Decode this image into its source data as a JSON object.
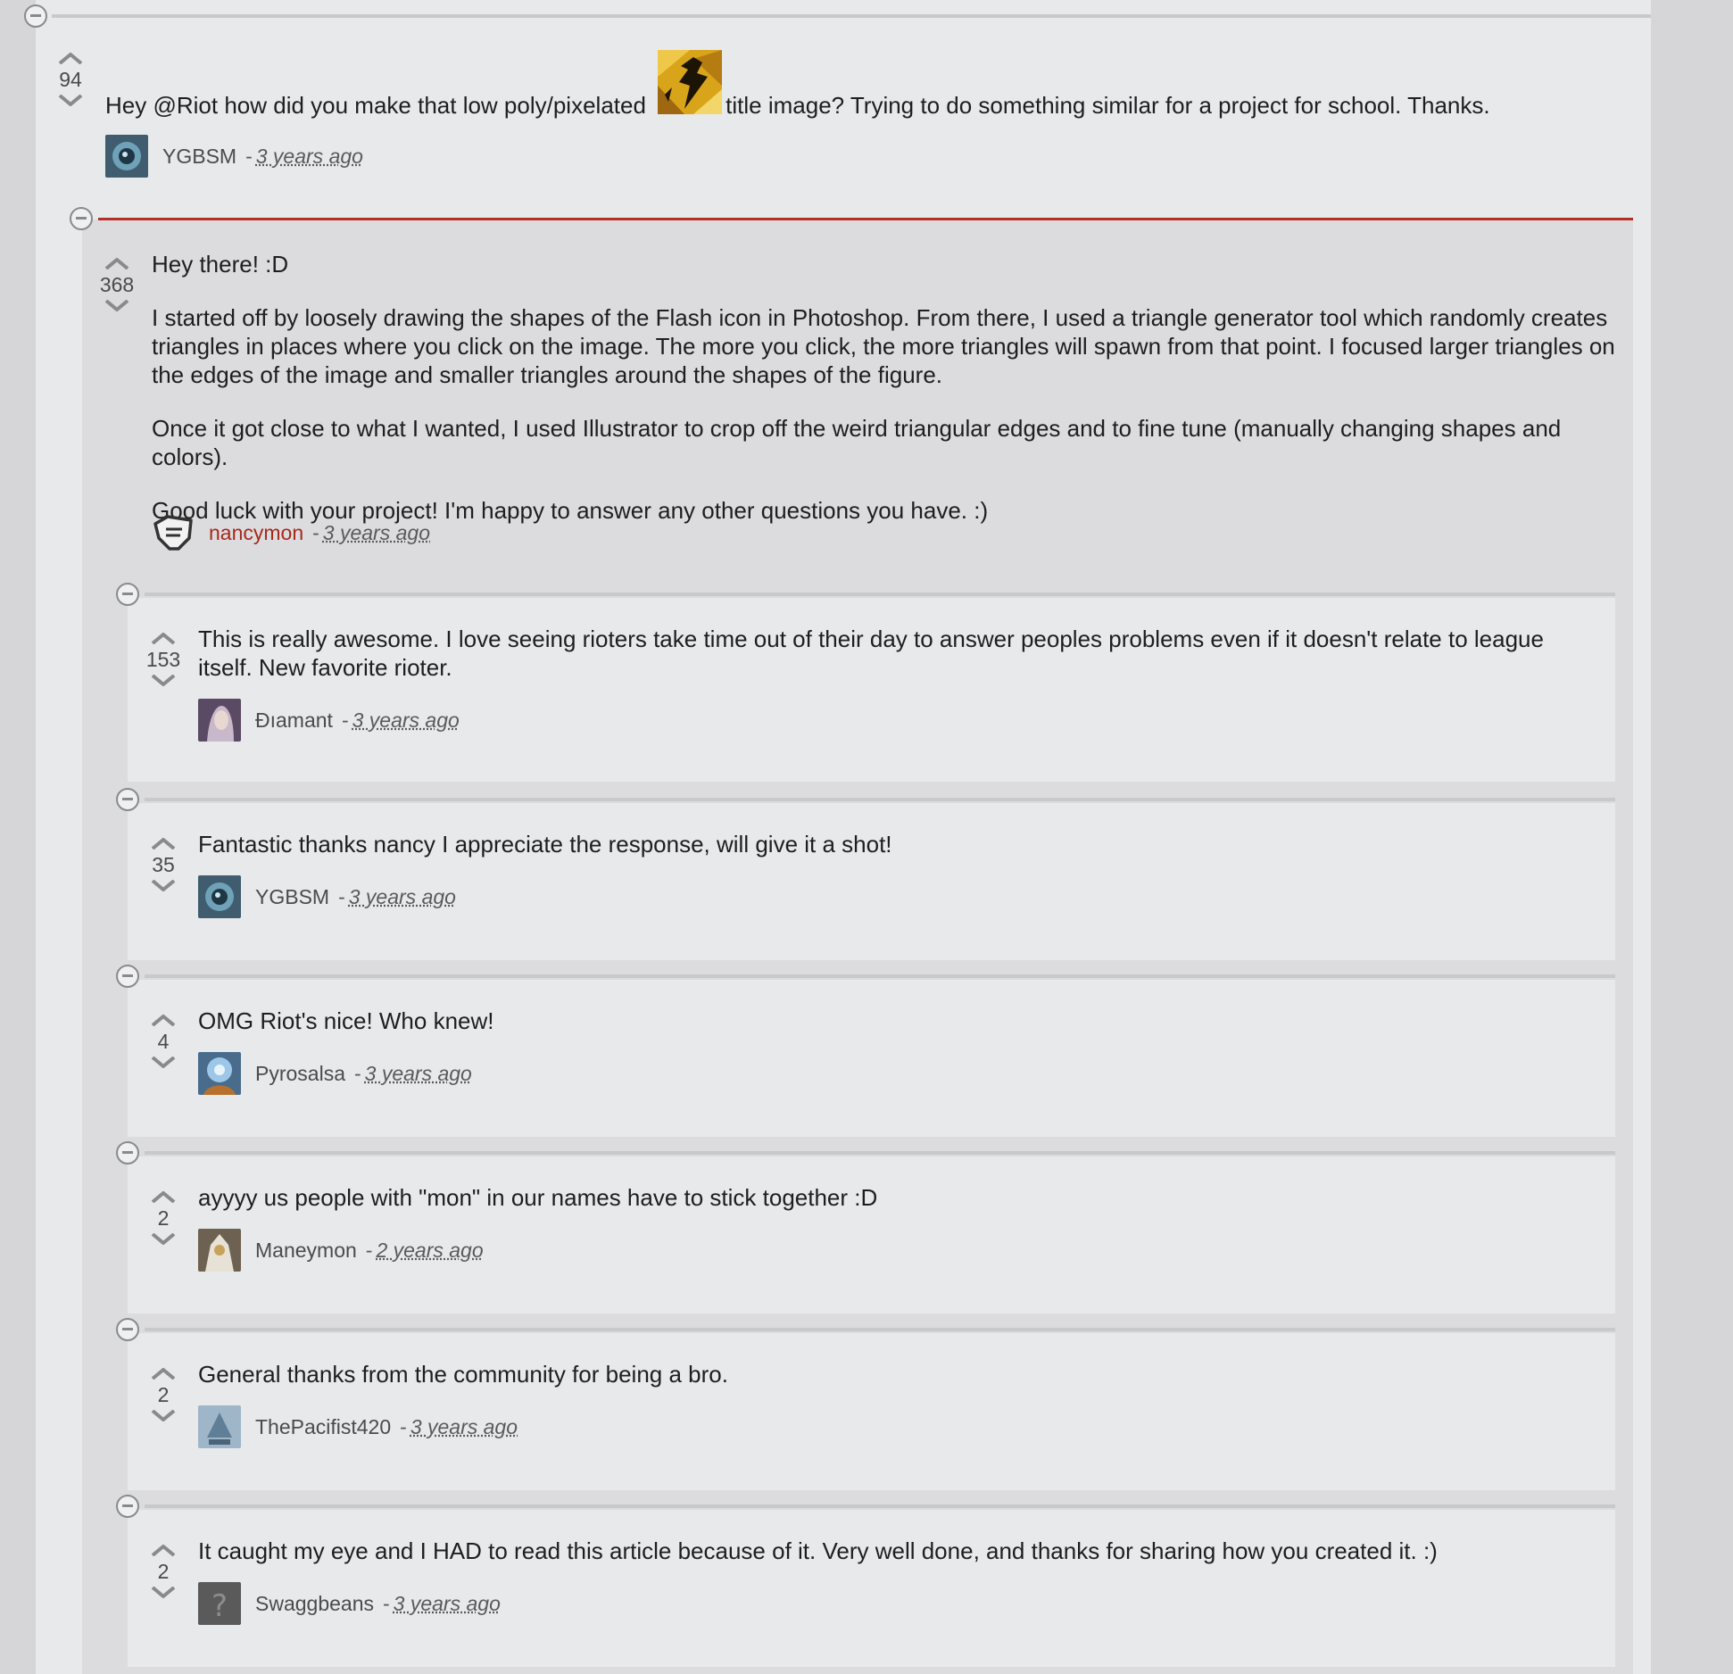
{
  "comments": [
    {
      "votes": "94",
      "text_before": "Hey @Riot how did you make that low poly/pixelated",
      "text_after": "title image? Trying to do something similar for a project for school. Thanks.",
      "author": "YGBSM",
      "time": "3 years ago"
    },
    {
      "votes": "368",
      "paragraphs": [
        "Hey there! :D",
        "I started off by loosely drawing the shapes of the Flash icon in Photoshop. From there, I used a triangle generator tool which randomly creates triangles in places where you click on the image. The more you click, the more triangles will spawn from that point. I focused larger triangles on the edges of the image and smaller triangles around the shapes of the figure.",
        "Once it got close to what I wanted, I used Illustrator to crop off the weird triangular edges and to fine tune (manually changing shapes and colors).",
        "Good luck with your project! I'm happy to answer any other questions you have. :)"
      ],
      "author": "nancymon",
      "time": "3 years ago"
    }
  ],
  "replies": [
    {
      "votes": "153",
      "text": "This is really awesome. I love seeing rioters take time out of their day to answer peoples problems even if it doesn't relate to league itself. New favorite rioter.",
      "author": "Đıamant",
      "time": "3 years ago"
    },
    {
      "votes": "35",
      "text": "Fantastic thanks nancy I appreciate the response, will give it a shot!",
      "author": "YGBSM",
      "time": "3 years ago"
    },
    {
      "votes": "4",
      "text": "OMG Riot's nice! Who knew!",
      "author": "Pyrosalsa",
      "time": "3 years ago"
    },
    {
      "votes": "2",
      "text": "ayyyy us people with \"mon\" in our names have to stick together :D",
      "author": "Maneymon",
      "time": "2 years ago"
    },
    {
      "votes": "2",
      "text": "General thanks from the community for being a bro.",
      "author": "ThePacifist420",
      "time": "3 years ago"
    },
    {
      "votes": "2",
      "text": "It caught my eye and I HAD to read this article because of it. Very well done, and thanks for sharing how you created it. :)",
      "author": "Swaggbeans",
      "time": "3 years ago"
    }
  ],
  "separator": "-",
  "icons": {
    "collapse": "minus-circle-icon",
    "upvote": "chevron-up-icon",
    "downvote": "chevron-down-icon",
    "inline_image": "flash-image-icon",
    "unknown_avatar": "question-mark-icon",
    "riot_avatar": "riot-fist-icon"
  },
  "colors": {
    "riot_red": "#a7291c",
    "divider_red": "#b23024",
    "page_bg": "#e8e9eb",
    "reply_bg": "#dcdcde"
  }
}
